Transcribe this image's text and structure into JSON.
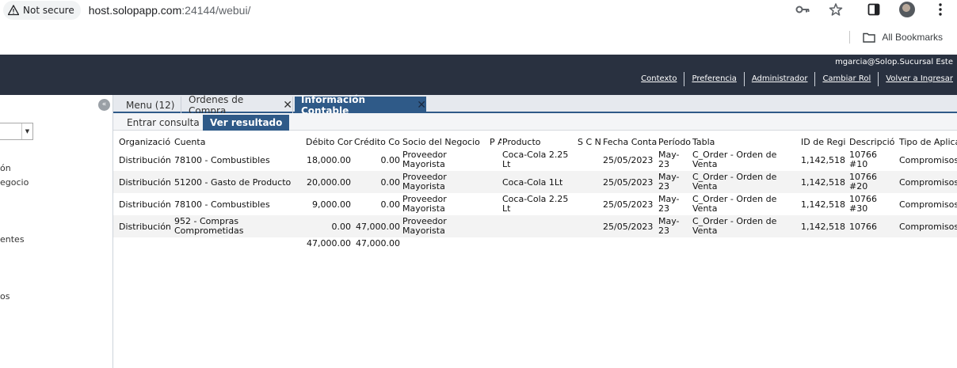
{
  "browser": {
    "security_label": "Not secure",
    "url_host": "host.solopapp.com",
    "url_rest": ":24144/webui/",
    "bookmarks_label": "All Bookmarks"
  },
  "header": {
    "user": "mgarcia@Solop.Sucursal Este",
    "links": [
      "Contexto",
      "Preferencia",
      "Administrador",
      "Cambiar Rol",
      "Volver a Ingresar"
    ]
  },
  "left_panel": {
    "items": [
      "ón",
      "egocio",
      "entes",
      "os"
    ]
  },
  "tabs": [
    {
      "label": "Menu (12)"
    },
    {
      "label": "Órdenes de Compra"
    },
    {
      "label": "Información Contable"
    }
  ],
  "subtabs": [
    "Entrar consulta",
    "Ver resultado"
  ],
  "grid": {
    "columns": [
      "Organizació",
      "Cuenta",
      "Débito Cor",
      "Crédito Co",
      "Socio del Negocio",
      "P A",
      "Producto",
      "S C N",
      "Fecha Conta",
      "Período",
      "Tabla",
      "ID de Regi",
      "Descripció",
      "Tipo de Aplica"
    ],
    "rows": [
      {
        "org": "Distribución",
        "cuenta": "78100 - Combustibles",
        "debito": "18,000.00",
        "credito": "0.00",
        "socio": "Proveedor Mayorista",
        "producto": "Coca-Cola 2.25 Lt",
        "fecha": "25/05/2023",
        "periodo": "May-23",
        "tabla": "C_Order - Orden de Venta",
        "id": "1,142,518",
        "desc": "10766 #10",
        "tipo": "Compromisos"
      },
      {
        "org": "Distribución",
        "cuenta": "51200 - Gasto de Producto",
        "debito": "20,000.00",
        "credito": "0.00",
        "socio": "Proveedor Mayorista",
        "producto": "Coca-Cola 1Lt",
        "fecha": "25/05/2023",
        "periodo": "May-23",
        "tabla": "C_Order - Orden de Venta",
        "id": "1,142,518",
        "desc": "10766 #20",
        "tipo": "Compromisos"
      },
      {
        "org": "Distribución",
        "cuenta": "78100 - Combustibles",
        "debito": "9,000.00",
        "credito": "0.00",
        "socio": "Proveedor Mayorista",
        "producto": "Coca-Cola 2.25 Lt",
        "fecha": "25/05/2023",
        "periodo": "May-23",
        "tabla": "C_Order - Orden de Venta",
        "id": "1,142,518",
        "desc": "10766 #30",
        "tipo": "Compromisos"
      },
      {
        "org": "Distribución",
        "cuenta": "952 - Compras Comprometidas",
        "debito": "0.00",
        "credito": "47,000.00",
        "socio": "Proveedor Mayorista",
        "producto": "",
        "fecha": "25/05/2023",
        "periodo": "May-23",
        "tabla": "C_Order - Orden de Venta",
        "id": "1,142,518",
        "desc": "10766",
        "tipo": "Compromisos"
      }
    ],
    "totals": {
      "debito": "47,000.00",
      "credito": "47,000.00"
    }
  }
}
